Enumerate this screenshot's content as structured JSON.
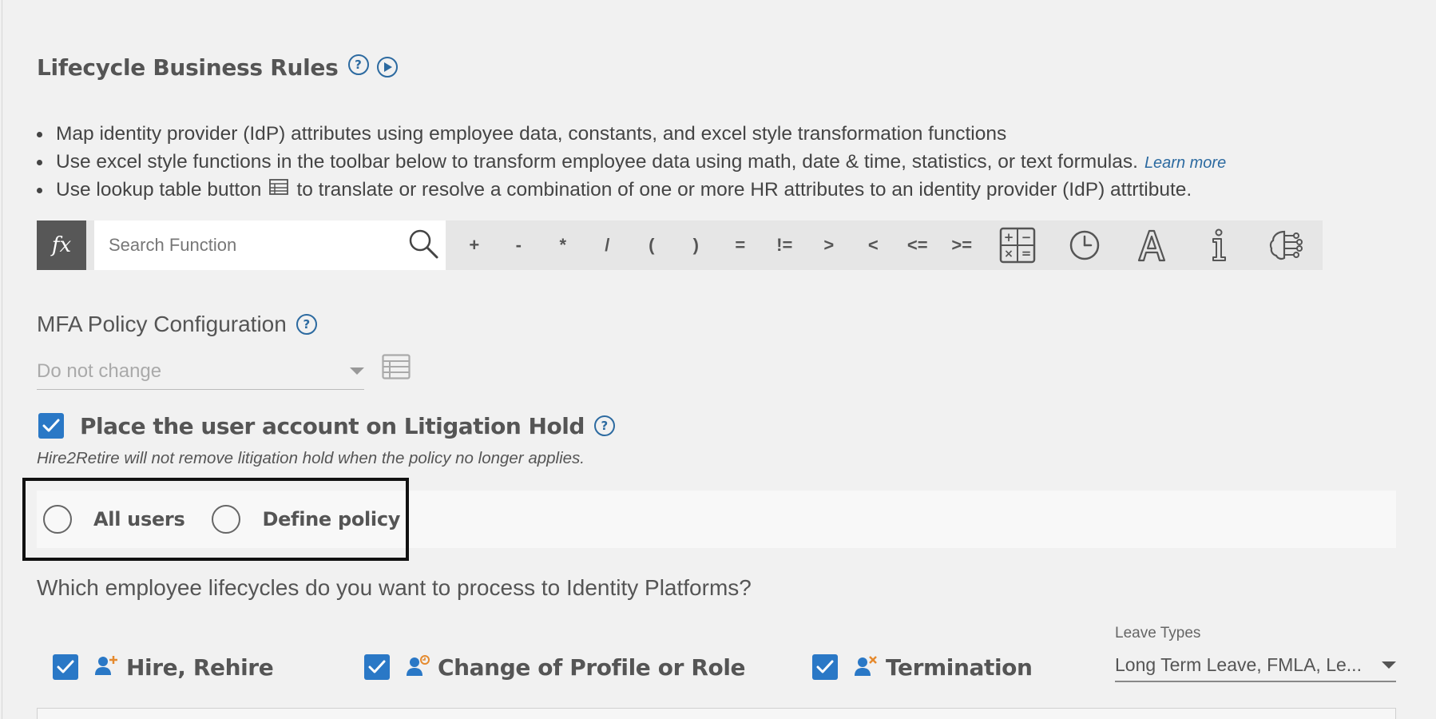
{
  "header": {
    "title": "Lifecycle Business Rules"
  },
  "bullets": [
    {
      "text": "Map identity provider (IdP) attributes using employee data, constants, and excel style transformation functions"
    },
    {
      "text": "Use excel style functions in the toolbar below to transform employee data using math, date & time, statistics, or text formulas.",
      "link": "Learn more"
    },
    {
      "before": "Use lookup table button",
      "after": "to translate or resolve a combination of one or more HR attributes to an identity provider (IdP) attrtibute."
    }
  ],
  "toolbar": {
    "fx_label": "fx",
    "search_placeholder": "Search Function",
    "operators": [
      "+",
      "-",
      "*",
      "/",
      "(",
      ")",
      "=",
      "!=",
      ">",
      "<",
      "<=",
      ">="
    ]
  },
  "mfa": {
    "label": "MFA Policy Configuration",
    "selected": "Do not change"
  },
  "litigation": {
    "label": "Place the user account on Litigation Hold",
    "checked": true,
    "note": "Hire2Retire will not remove litigation hold when the policy no longer applies."
  },
  "policy_options": {
    "all_users": "All users",
    "define_policy": "Define policy"
  },
  "lifecycle_question": "Which employee lifecycles do you want to process to Identity Platforms?",
  "lifecycles": {
    "hire": "Hire, Rehire",
    "change": "Change of Profile or Role",
    "termination": "Termination"
  },
  "leave_types": {
    "label": "Leave Types",
    "value": "Long Term Leave, FMLA, Le..."
  },
  "colors": {
    "accent": "#2a78c6",
    "link": "#2c6aa0",
    "fx_bg": "#575757",
    "toolbar_bg": "#e6e6e6"
  }
}
